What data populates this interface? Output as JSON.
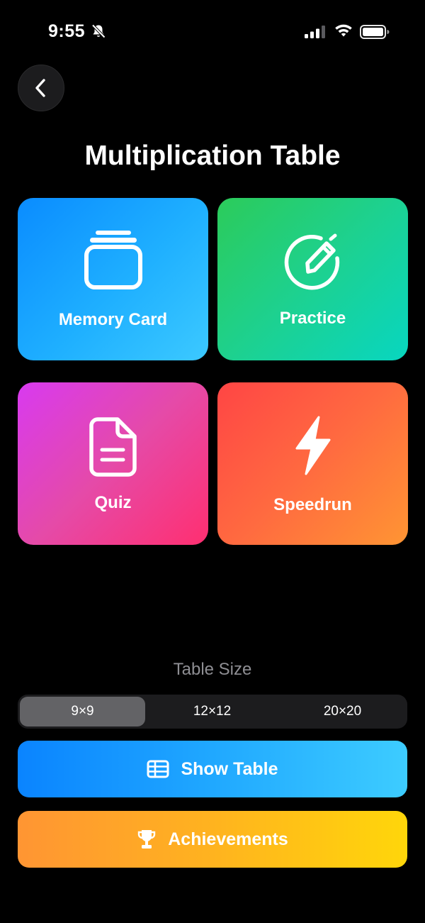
{
  "status_bar": {
    "time": "9:55",
    "icons": [
      "bell-slash-icon",
      "cellular-signal-icon",
      "wifi-icon",
      "battery-icon"
    ]
  },
  "nav": {
    "back_icon": "chevron-left-icon"
  },
  "title": "Multiplication Table",
  "modes": [
    {
      "label": "Memory Card",
      "icon": "cards-stack-icon",
      "colors": [
        "#0a8cff",
        "#3cc9ff"
      ]
    },
    {
      "label": "Practice",
      "icon": "pencil-circle-icon",
      "colors": [
        "#2ccb5a",
        "#08d6c0"
      ]
    },
    {
      "label": "Quiz",
      "icon": "document-icon",
      "colors": [
        "#d83af0",
        "#ff2f70"
      ]
    },
    {
      "label": "Speedrun",
      "icon": "bolt-icon",
      "colors": [
        "#ff4545",
        "#ff9533"
      ]
    }
  ],
  "table_size": {
    "label": "Table Size",
    "options": [
      "9×9",
      "12×12",
      "20×20"
    ],
    "selected": "9×9"
  },
  "buttons": {
    "show_table": {
      "label": "Show Table",
      "icon": "table-icon"
    },
    "achievements": {
      "label": "Achievements",
      "icon": "trophy-icon"
    }
  }
}
